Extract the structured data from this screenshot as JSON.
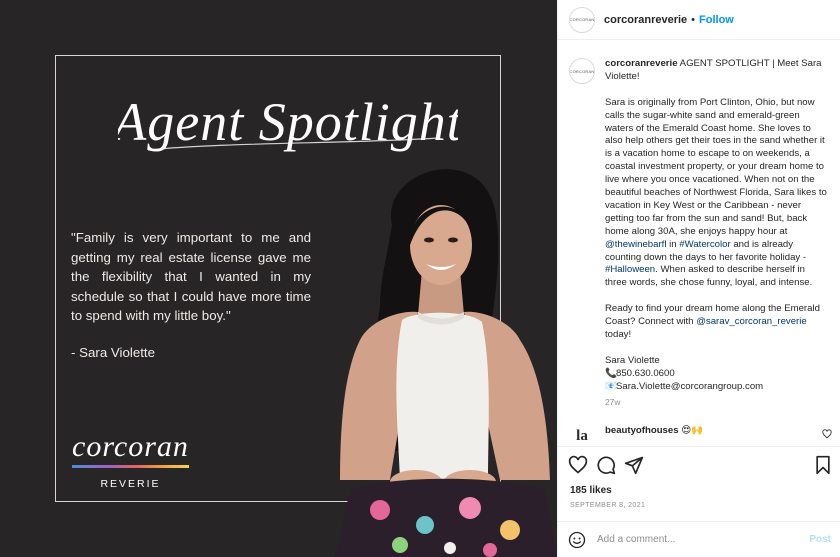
{
  "post_image": {
    "script_title": "Agent Spotlight",
    "quote": "\"Family is very important to me and getting my real estate license gave me the flexibility that I wanted in my schedule so that I could have more time to spend with my little boy.\"",
    "quote_by": "- Sara Violette",
    "logo": {
      "word": "corcoran",
      "sub": "REVERIE"
    }
  },
  "header": {
    "avatar_text": "CORCORAN",
    "username": "corcoranreverie",
    "separator": "•",
    "follow": "Follow"
  },
  "caption": {
    "username": "corcoranreverie",
    "headline": "AGENT SPOTLIGHT | Meet Sara Violette!",
    "p1_a": "Sara is originally from Port Clinton, Ohio, but now calls the sugar-white sand and emerald-green waters of the Emerald Coast home. She loves to also help others get their toes in the sand whether it is a vacation home to escape to on weekends, a coastal investment property, or your dream home to live where you once vacationed. When not on the beautiful beaches of Northwest Florida, Sara likes to vacation in Key West or the Caribbean - never getting too far from the sun and sand! But, back home along 30A, she enjoys happy hour at ",
    "tag_winebar": "@thewinebarfl",
    "p1_in": " in ",
    "tag_watercolor": "#Watercolor",
    "p1_b": " and is already counting down the days to her favorite holiday - ",
    "tag_halloween": "#Halloween",
    "p1_c": ". When asked to describe herself in three words, she chose funny, loyal, and intense.",
    "p2_a": "Ready to find your dream home along the Emerald Coast? Connect with ",
    "tag_sara": "@sarav_corcoran_reverie",
    "p2_b": " today!",
    "sig_name": "Sara Violette",
    "phone_icon": "📞",
    "phone": "850.630.0600",
    "mail_icon": "📧",
    "email": "Sara.Violette@corcorangroup.com",
    "age": "27w"
  },
  "comment": {
    "avatar_text": "la",
    "username": "beautyofhouses",
    "emoji": "😍🙌"
  },
  "actions": {
    "likes": "185 likes",
    "date": "SEPTEMBER 8, 2021"
  },
  "add_comment": {
    "placeholder": "Add a comment...",
    "post": "Post"
  },
  "colors": {
    "accent": "#0095f6",
    "link": "#00376b",
    "post_disabled": "#b2dffc",
    "image_bg": "#282526"
  }
}
